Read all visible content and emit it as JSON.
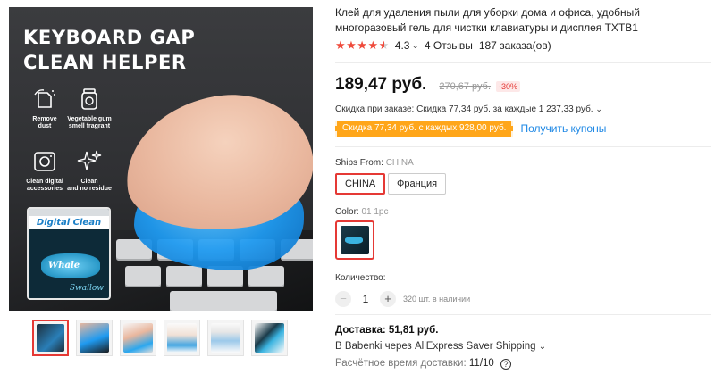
{
  "gallery": {
    "hero_title": "KEYBOARD GAP\nCLEAN HELPER",
    "features": [
      {
        "icon": "dust-icon",
        "text": "Remove\ndust"
      },
      {
        "icon": "jar-icon",
        "text": "Vegetable gum\nsmell fragrant"
      },
      {
        "icon": "camera-icon",
        "text": "Clean digital\naccessories"
      },
      {
        "icon": "sparkle-icon",
        "text": "Clean\nand no residue"
      }
    ],
    "pack_name": "Digital Clean",
    "pack_whale": "Whale",
    "pack_brand": "Swallow",
    "thumbnails": 6,
    "active_thumbnail": 0
  },
  "product": {
    "title": "Клей для удаления пыли для уборки дома и офиса, удобный многоразовый гель для чистки клавиатуры и дисплея TXTB1",
    "rating": "4.3",
    "rating_stars": 4.3,
    "reviews": "4 Отзывы",
    "orders": "187 заказа(ов)",
    "price": "189,47 руб.",
    "old_price": "270,67 руб.",
    "discount": "-30%",
    "order_discount": "Скидка при заказе: Скидка 77,34 руб. за каждые 1 237,33 руб.",
    "coupon": "Скидка 77,34 руб. с каждых 928,00 руб.",
    "get_coupons": "Получить купоны",
    "ships_from_label": "Ships From:",
    "ships_from_value": "CHINA",
    "ship_options": [
      "CHINA",
      "Франция"
    ],
    "selected_ship": "CHINA",
    "color_label": "Color:",
    "color_value": "01 1pc",
    "quantity_label": "Количество:",
    "quantity": "1",
    "stock": "320 шт. в наличии",
    "delivery": "Доставка: 51,81 руб.",
    "delivery_route": "В Babenki через AliExpress Saver Shipping",
    "delivery_time_label": "Расчётное время доставки:",
    "delivery_time": "11/10"
  },
  "colors": {
    "accent": "#e53935",
    "star": "#ef4b3c",
    "coupon_bg": "#ffa61a",
    "link": "#1e88e5"
  }
}
